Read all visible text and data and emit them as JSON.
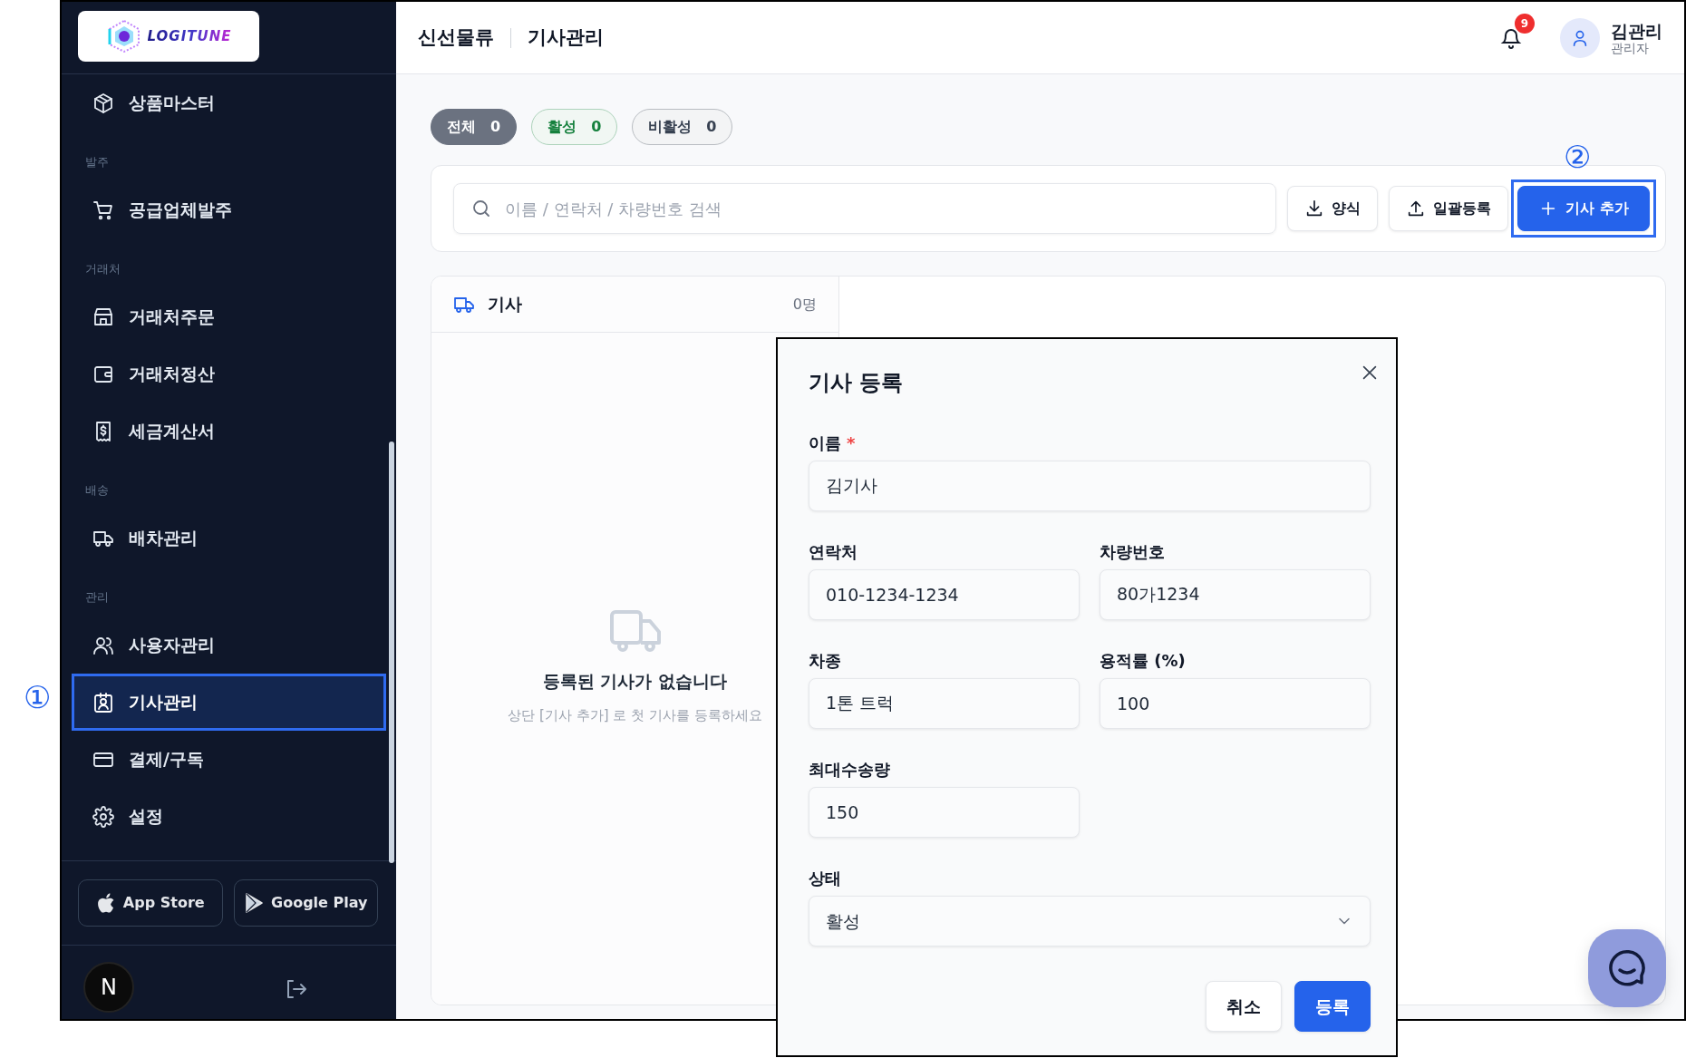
{
  "callouts": [
    "①",
    "②"
  ],
  "sidebar": {
    "logo": "LOGITUNE",
    "sections": [
      {
        "items": [
          {
            "label": "상품마스터",
            "selected": false,
            "highlighted": false
          }
        ]
      },
      {
        "title": "발주",
        "items": [
          {
            "label": "공급업체발주",
            "selected": false,
            "highlighted": false
          }
        ]
      },
      {
        "title": "거래처",
        "items": [
          {
            "label": "거래처주문",
            "selected": false,
            "highlighted": false
          },
          {
            "label": "거래처정산",
            "selected": false,
            "highlighted": false
          },
          {
            "label": "세금계산서",
            "selected": false,
            "highlighted": false
          }
        ]
      },
      {
        "title": "배송",
        "items": [
          {
            "label": "배차관리",
            "selected": false,
            "highlighted": false
          }
        ]
      },
      {
        "title": "관리",
        "items": [
          {
            "label": "사용자관리",
            "selected": false,
            "highlighted": false
          },
          {
            "label": "기사관리",
            "selected": true,
            "highlighted": true
          },
          {
            "label": "결제/구독",
            "selected": false,
            "highlighted": false
          },
          {
            "label": "설정",
            "selected": false,
            "highlighted": false
          }
        ]
      }
    ],
    "store_buttons": [
      "App Store",
      "Google Play"
    ],
    "dev_badge": "N"
  },
  "header": {
    "breadcrumb": [
      "신선물류",
      "기사관리"
    ],
    "notification_count": "9",
    "user": {
      "name": "김관리",
      "role": "관리자"
    }
  },
  "filters": [
    {
      "label": "전체",
      "count": "0",
      "selected": true,
      "color": "#6b7280"
    },
    {
      "label": "활성",
      "count": "0",
      "selected": false,
      "color": "#15803d"
    },
    {
      "label": "비활성",
      "count": "0",
      "selected": false,
      "color": "#374151"
    }
  ],
  "toolbar": {
    "search": {
      "placeholder": "이름 / 연락처 / 차량번호 검색"
    },
    "buttons": [
      {
        "label": "양식",
        "kind": "secondary",
        "highlighted": false
      },
      {
        "label": "일괄등록",
        "kind": "secondary",
        "highlighted": false
      },
      {
        "label": "기사 추가",
        "kind": "primary",
        "highlighted": true
      }
    ]
  },
  "list_panel": {
    "title": "기사",
    "count": "0명",
    "empty_title": "등록된 기사가 없습니다",
    "empty_hint": "상단 [기사 추가] 로 첫 기사를 등록하세요"
  },
  "modal": {
    "title": "기사 등록",
    "fields": [
      {
        "label": "이름",
        "required_mark": "*",
        "value": "김기사",
        "kind": "text",
        "wide": true
      },
      {
        "label": "연락처",
        "value": "010-1234-1234",
        "kind": "text",
        "wide": false
      },
      {
        "label": "차량번호",
        "value": "80가1234",
        "kind": "text",
        "wide": false
      },
      {
        "label": "차종",
        "value": "1톤 트럭",
        "kind": "text",
        "wide": false
      },
      {
        "label": "용적률 (%)",
        "value": "100",
        "kind": "text",
        "wide": false
      },
      {
        "label": "최대수송량",
        "value": "150",
        "kind": "text",
        "wide": false
      },
      {
        "label": "상태",
        "value": "활성",
        "kind": "select",
        "wide": true
      }
    ],
    "buttons": [
      {
        "label": "취소",
        "kind": "secondary"
      },
      {
        "label": "등록",
        "kind": "primary"
      }
    ]
  }
}
